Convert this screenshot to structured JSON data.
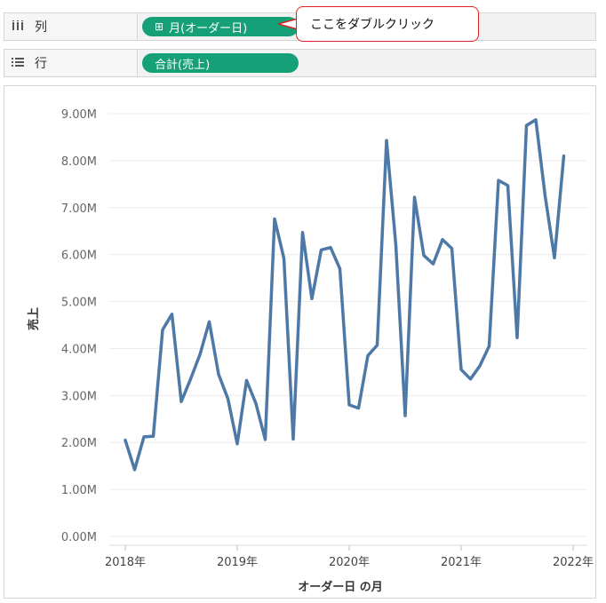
{
  "shelves": {
    "columns": {
      "icon": "columns-icon",
      "label": "列",
      "pill": "月(オーダー日)"
    },
    "rows": {
      "icon": "rows-icon",
      "label": "行",
      "pill": "合計(売上)"
    }
  },
  "callout": {
    "text": "ここをダブルクリック"
  },
  "colors": {
    "pill": "#16a077",
    "line": "#4e79a7",
    "callout_border": "#e02020"
  },
  "chart_data": {
    "type": "line",
    "xlabel": "オーダー日 の月",
    "ylabel": "売上",
    "ylim": [
      0,
      9000000
    ],
    "yticks": [
      "0.00M",
      "1.00M",
      "2.00M",
      "3.00M",
      "4.00M",
      "5.00M",
      "6.00M",
      "7.00M",
      "8.00M",
      "9.00M"
    ],
    "xticks": [
      "2018年",
      "2019年",
      "2020年",
      "2021年",
      "2022年"
    ],
    "series": [
      {
        "values": [
          2.05,
          1.42,
          2.12,
          2.13,
          4.4,
          4.73,
          2.87,
          3.35,
          3.87,
          4.57,
          3.45,
          2.93,
          1.97,
          3.32,
          2.83,
          2.06,
          6.76,
          5.92,
          2.07,
          6.47,
          5.06,
          6.1,
          6.15,
          5.7,
          2.8,
          2.73,
          3.85,
          4.07,
          8.43,
          6.2,
          2.57,
          7.22,
          5.98,
          5.8,
          6.32,
          6.13,
          3.55,
          3.35,
          3.63,
          4.05,
          7.58,
          7.47,
          4.23,
          8.75,
          8.87,
          7.25,
          5.93,
          8.1
        ]
      }
    ],
    "start": "2018-01",
    "units": "M"
  }
}
